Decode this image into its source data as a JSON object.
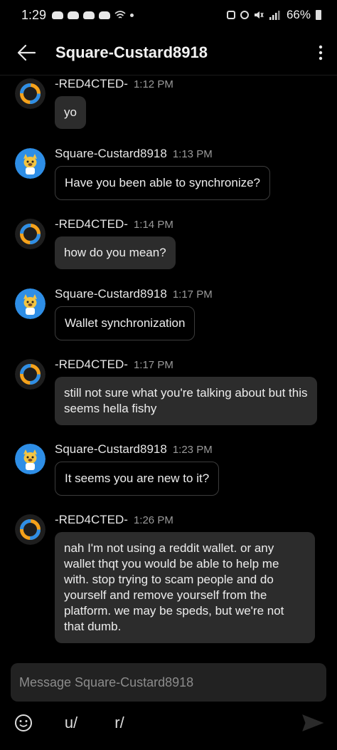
{
  "status_bar": {
    "time": "1:29",
    "battery": "66%"
  },
  "header": {
    "title": "Square-Custard8918",
    "back_icon": "arrow-left-icon",
    "menu_icon": "more-vertical-icon"
  },
  "messages": [
    {
      "author": "-RED4CTED-",
      "time": "1:12 PM",
      "text": "yo",
      "type": "theirs"
    },
    {
      "author": "Square-Custard8918",
      "time": "1:13 PM",
      "text": "Have you been able to synchronize?",
      "type": "mine"
    },
    {
      "author": "-RED4CTED-",
      "time": "1:14 PM",
      "text": "how do you mean?",
      "type": "theirs"
    },
    {
      "author": "Square-Custard8918",
      "time": "1:17 PM",
      "text": "Wallet synchronization",
      "type": "mine"
    },
    {
      "author": "-RED4CTED-",
      "time": "1:17 PM",
      "text": "still not sure what you're talking about but this seems hella fishy",
      "type": "theirs"
    },
    {
      "author": "Square-Custard8918",
      "time": "1:23 PM",
      "text": "It seems you are new to it?",
      "type": "mine"
    },
    {
      "author": "-RED4CTED-",
      "time": "1:26 PM",
      "text": "nah I'm not using a reddit wallet. or any wallet thqt you would be able to help me with. stop trying to scam people and do yourself and remove yourself from the platform. we may be speds, but we're not that dumb.",
      "type": "theirs"
    }
  ],
  "composer": {
    "placeholder": "Message Square-Custard8918"
  },
  "toolbar": {
    "emoji_icon": "emoji-icon",
    "user_label": "u/",
    "subreddit_label": "r/",
    "send_icon": "send-icon"
  },
  "colors": {
    "background": "#000000",
    "bubble_theirs": "#2c2c2c",
    "bubble_border_mine": "#3c3c3c",
    "avatar_blue": "#2e8ee6",
    "avatar_orange": "#f6a21a"
  }
}
